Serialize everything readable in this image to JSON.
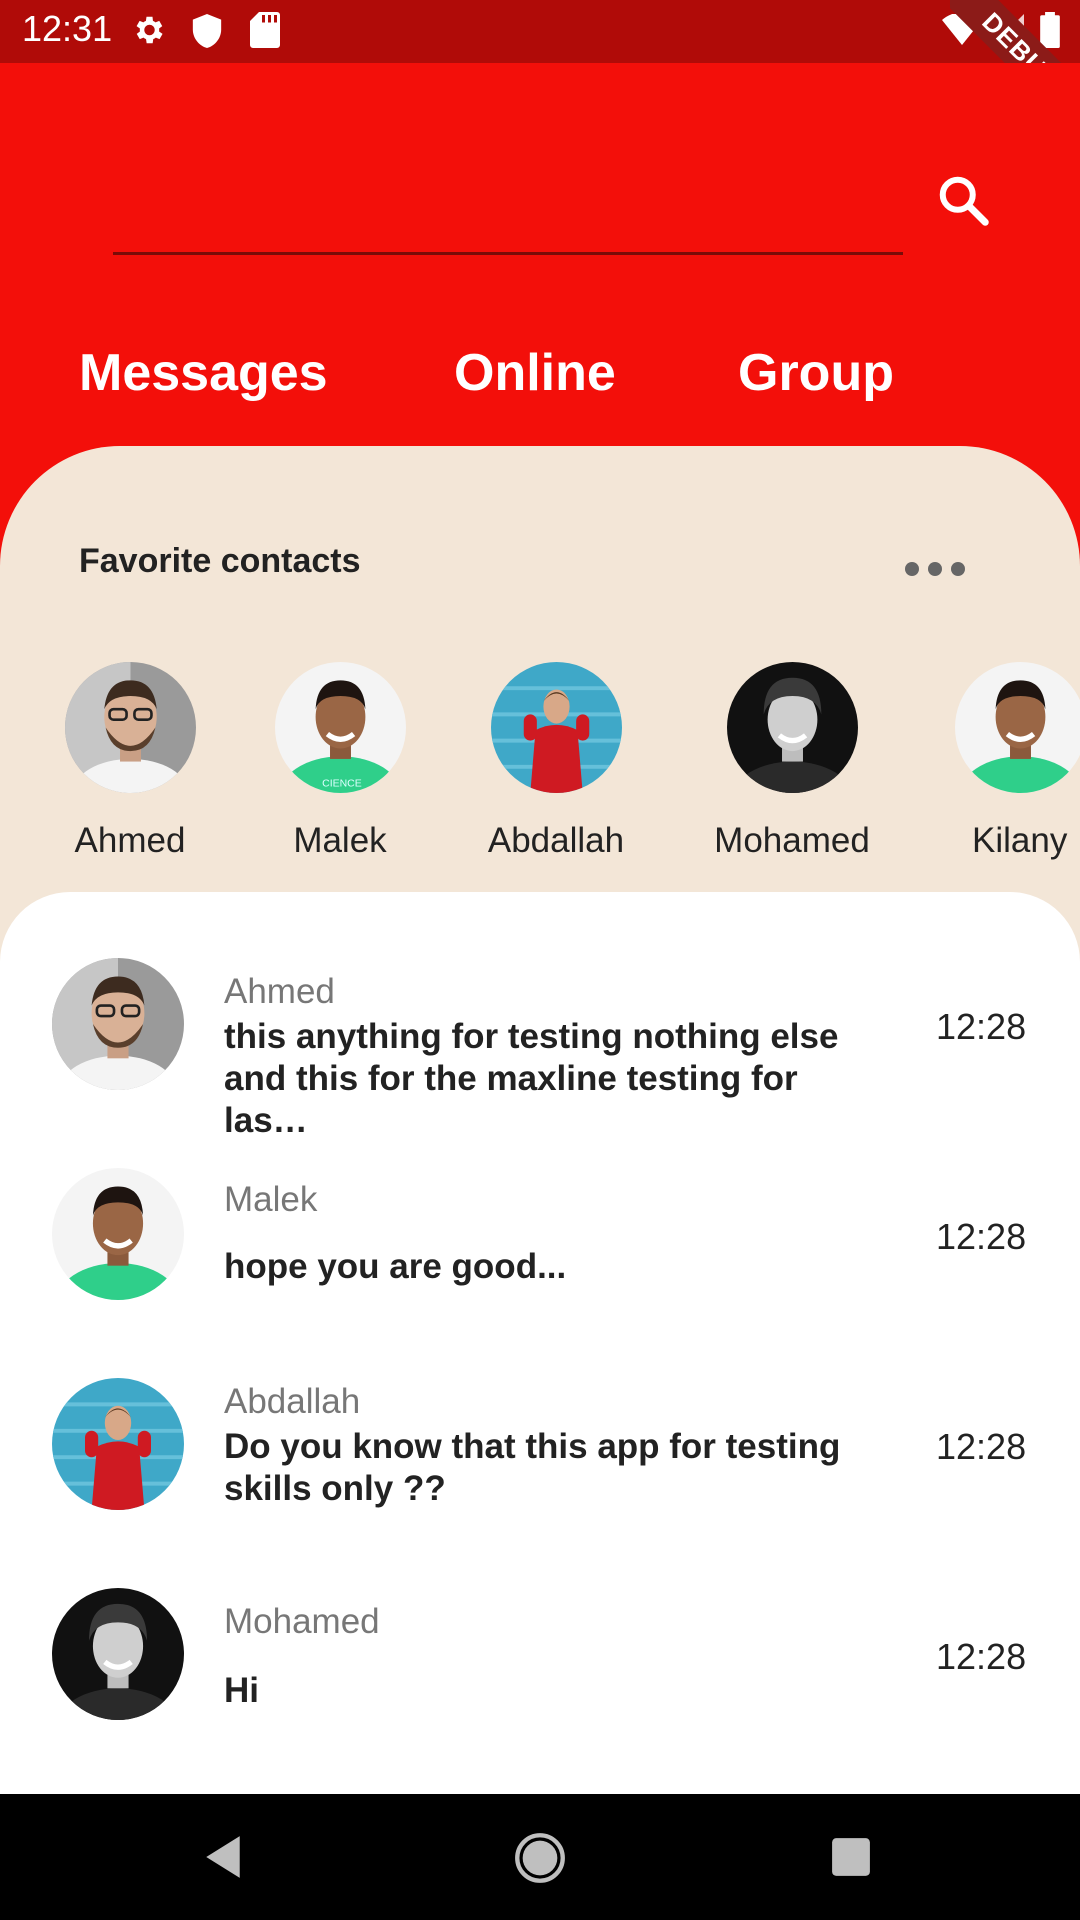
{
  "status_bar": {
    "time": "12:31",
    "icons": [
      "gear-icon",
      "shield-icon",
      "sd-card-icon",
      "wifi-icon",
      "signal-icon",
      "battery-icon"
    ],
    "debug_label": "DEBUG"
  },
  "header": {
    "search_icon": "search-icon",
    "tabs": [
      {
        "label": "Messages"
      },
      {
        "label": "Online"
      },
      {
        "label": "Group"
      }
    ]
  },
  "favorites": {
    "title": "Favorite contacts",
    "more_icon": "more-horizontal-icon",
    "contacts": [
      {
        "name": "Ahmed"
      },
      {
        "name": "Malek"
      },
      {
        "name": "Abdallah"
      },
      {
        "name": "Mohamed"
      },
      {
        "name": "Kilany"
      }
    ]
  },
  "messages": [
    {
      "name": "Ahmed",
      "text": "this anything for testing nothing else and this for the maxline testing for las…",
      "time": "12:28"
    },
    {
      "name": "Malek",
      "text": "hope you are good...",
      "time": "12:28"
    },
    {
      "name": "Abdallah",
      "text": "Do you know that this app for testing skills only ??",
      "time": "12:28"
    },
    {
      "name": "Mohamed",
      "text": "Hi",
      "time": "12:28"
    }
  ],
  "nav_bar": {
    "icons": [
      "back-icon",
      "home-icon",
      "recents-icon"
    ]
  },
  "colors": {
    "header_red": "#f30f0a",
    "status_red": "#b00b08",
    "favorites_bg": "#f3e6d7",
    "list_bg": "#ffffff"
  }
}
